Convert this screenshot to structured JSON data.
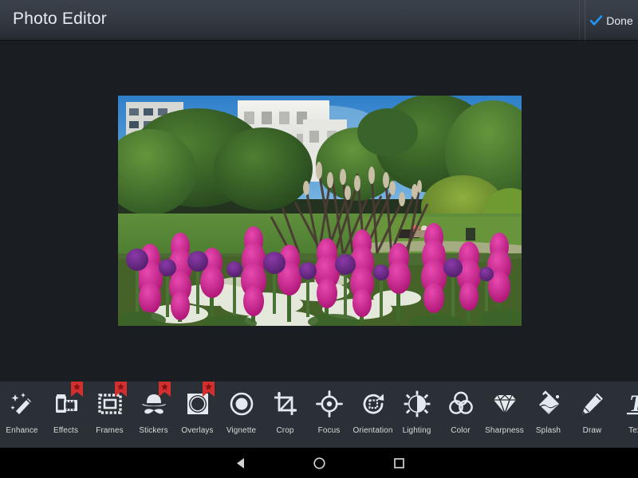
{
  "app": {
    "title": "Photo Editor",
    "background_color": "#1a1d21",
    "header_color": "#353b43",
    "toolbar_color": "#2b3036"
  },
  "header": {
    "title": "Photo Editor",
    "done": {
      "label": "Done",
      "icon": "check-icon",
      "accent_color": "#2196f3"
    }
  },
  "canvas": {
    "photo": {
      "name": "edited-photo",
      "description": "Garden scene with magenta foxglove and purple allium flowers, green trees, white buildings and blue sky"
    }
  },
  "toolbar": {
    "badge_color": "#d32f2f",
    "label_color": "#d6dadf",
    "items": [
      {
        "label": "Enhance",
        "icon": "magic-wand-icon",
        "badge": false
      },
      {
        "label": "Effects",
        "icon": "film-roll-icon",
        "badge": true
      },
      {
        "label": "Frames",
        "icon": "frame-icon",
        "badge": true
      },
      {
        "label": "Stickers",
        "icon": "hat-mustache-icon",
        "badge": true
      },
      {
        "label": "Overlays",
        "icon": "circle-square-icon",
        "badge": true
      },
      {
        "label": "Vignette",
        "icon": "vignette-icon",
        "badge": false
      },
      {
        "label": "Crop",
        "icon": "crop-icon",
        "badge": false
      },
      {
        "label": "Focus",
        "icon": "focus-target-icon",
        "badge": false
      },
      {
        "label": "Orientation",
        "icon": "rotate-icon",
        "badge": false
      },
      {
        "label": "Lighting",
        "icon": "brightness-sun-icon",
        "badge": false
      },
      {
        "label": "Color",
        "icon": "color-circles-icon",
        "badge": false
      },
      {
        "label": "Sharpness",
        "icon": "diamond-icon",
        "badge": false
      },
      {
        "label": "Splash",
        "icon": "paint-splash-icon",
        "badge": false
      },
      {
        "label": "Draw",
        "icon": "pencil-icon",
        "badge": false
      },
      {
        "label": "Text",
        "icon": "text-t-icon",
        "badge": false
      }
    ]
  },
  "navbar": {
    "back": "back-icon",
    "home": "home-icon",
    "recents": "recents-icon"
  }
}
